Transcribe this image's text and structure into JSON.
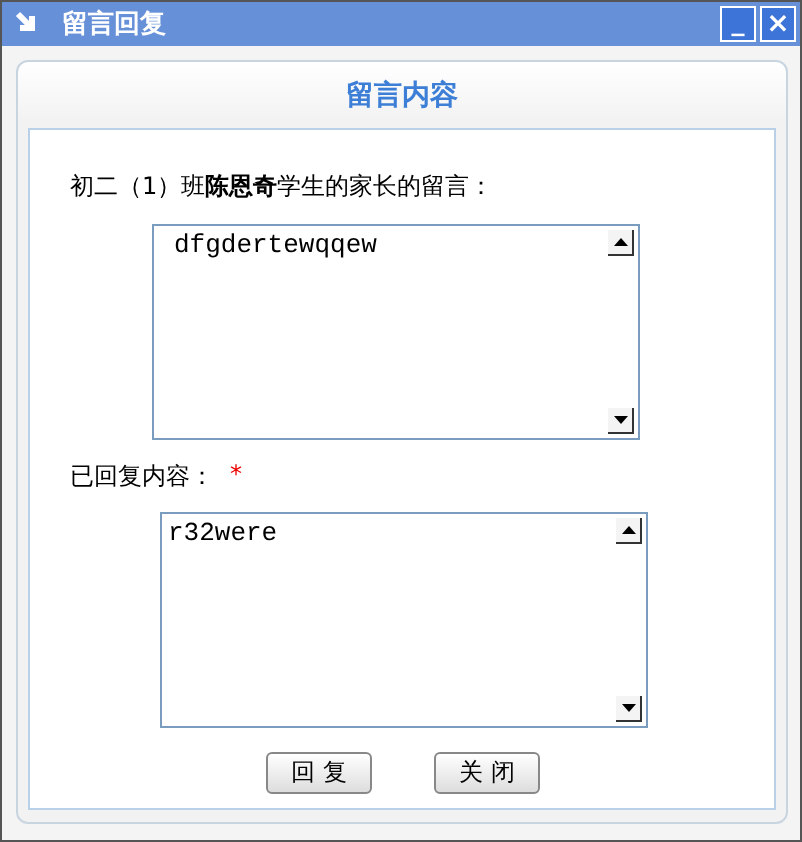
{
  "window": {
    "title": "留言回复",
    "controls": [
      {
        "kind": "minimize",
        "label": "_"
      },
      {
        "kind": "close",
        "label": "×"
      }
    ]
  },
  "panel": {
    "title": "留言内容"
  },
  "message": {
    "label": "初二（1）班**陈恩奇**学生的家长的留言：",
    "value": "dfgdertewqqew"
  },
  "reply": {
    "label": "已回复内容：",
    "required_mark": "*",
    "value": "r32were"
  },
  "buttons": [
    {
      "label": "回 复"
    },
    {
      "label": "关 闭"
    }
  ]
}
